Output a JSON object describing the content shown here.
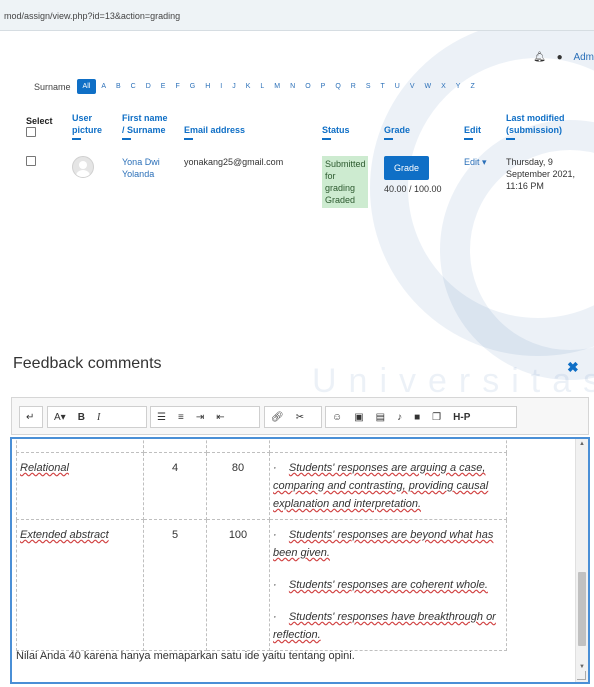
{
  "browser": {
    "url": "mod/assign/view.php?id=13&action=grading"
  },
  "header": {
    "user_short": "Adm",
    "bell_icon": "bell-icon",
    "chat_icon": "chat-icon"
  },
  "filter": {
    "label": "Surname",
    "letters": [
      "All",
      "A",
      "B",
      "C",
      "D",
      "E",
      "F",
      "G",
      "H",
      "I",
      "J",
      "K",
      "L",
      "M",
      "N",
      "O",
      "P",
      "Q",
      "R",
      "S",
      "T",
      "U",
      "V",
      "W",
      "X",
      "Y",
      "Z"
    ],
    "active": "All"
  },
  "table": {
    "headers": {
      "select": "Select",
      "user_picture": "User picture",
      "name": "First name / Surname",
      "email": "Email address",
      "status": "Status",
      "grade": "Grade",
      "edit": "Edit",
      "last_modified": "Last modified (submission)"
    },
    "row": {
      "name": "Yona Dwi Yolanda",
      "email": "yonakang25@gmail.com",
      "status": "Submitted for grading Graded",
      "grade_button": "Grade",
      "grade_value": "40.00 / 100.00",
      "edit_label": "Edit",
      "last_modified": "Thursday, 9 September 2021, 11:16 PM"
    }
  },
  "watermark": "Universitas",
  "feedback": {
    "title": "Feedback comments",
    "toolbar": [
      "undo-icon",
      "font-color-icon",
      "bold-icon",
      "italic-icon",
      "bullet-list-icon",
      "numbered-list-icon",
      "indent-icon",
      "outdent-icon",
      "link-icon",
      "unlink-icon",
      "emoji-icon",
      "image-icon",
      "media-icon",
      "record-audio-icon",
      "record-video-icon",
      "manage-files-icon",
      "h5p-icon"
    ],
    "toolbar_text": {
      "font_a": "A",
      "bold": "B",
      "italic": "I",
      "h5p": "H-P"
    },
    "rubric": [
      {
        "level": "Relational",
        "score": "4",
        "percent": "80",
        "descriptors": [
          "Students' responses are arguing a case, comparing and contrasting, providing causal explanation and interpretation."
        ]
      },
      {
        "level": "Extended abstract",
        "score": "5",
        "percent": "100",
        "descriptors": [
          "Students' responses are beyond what has been given.",
          "Students' responses are coherent whole.",
          "Students' responses have breakthrough or reflection."
        ]
      }
    ],
    "comment": "Nilai Anda 40 karena hanya memaparkan satu ide yaitu tentang opini."
  },
  "colors": {
    "accent": "#0f6fc6",
    "status_bg": "#cdebd0",
    "editor_border": "#4a8fd6"
  }
}
